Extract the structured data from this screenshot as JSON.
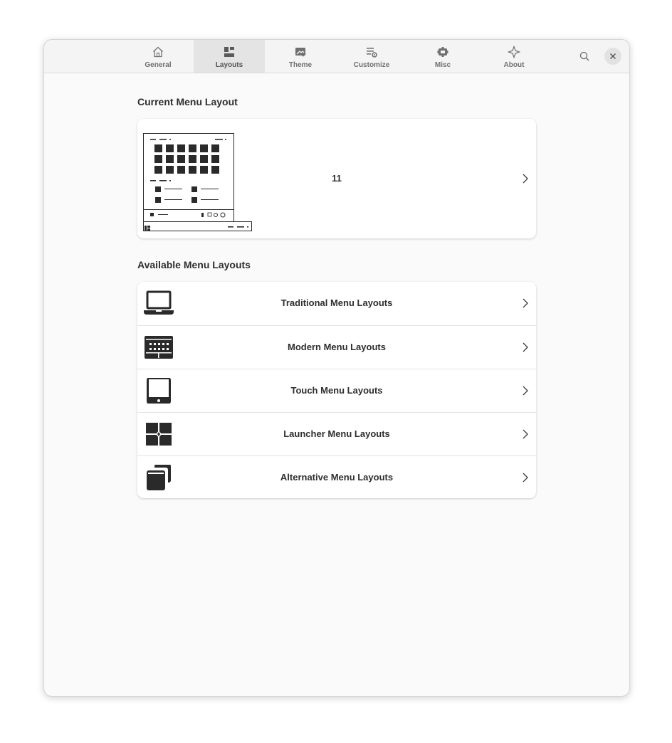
{
  "tabs": [
    {
      "label": "General",
      "icon": "home-icon"
    },
    {
      "label": "Layouts",
      "icon": "layouts-icon"
    },
    {
      "label": "Theme",
      "icon": "theme-icon"
    },
    {
      "label": "Customize",
      "icon": "customize-icon"
    },
    {
      "label": "Misc",
      "icon": "misc-icon"
    },
    {
      "label": "About",
      "icon": "about-icon"
    }
  ],
  "active_tab": "Layouts",
  "current_section": {
    "title": "Current Menu Layout",
    "layout_name": "11"
  },
  "available_section": {
    "title": "Available Menu Layouts",
    "items": [
      {
        "label": "Traditional Menu Layouts",
        "icon": "laptop-icon"
      },
      {
        "label": "Modern Menu Layouts",
        "icon": "keyboard-icon"
      },
      {
        "label": "Touch Menu Layouts",
        "icon": "tablet-icon"
      },
      {
        "label": "Launcher Menu Layouts",
        "icon": "launcher-grid-icon"
      },
      {
        "label": "Alternative Menu Layouts",
        "icon": "stacked-windows-icon"
      }
    ]
  },
  "colors": {
    "window_bg": "#fafafa",
    "card_bg": "#ffffff",
    "text": "#2e2e2e",
    "tab_active_bg": "#e4e4e4"
  }
}
